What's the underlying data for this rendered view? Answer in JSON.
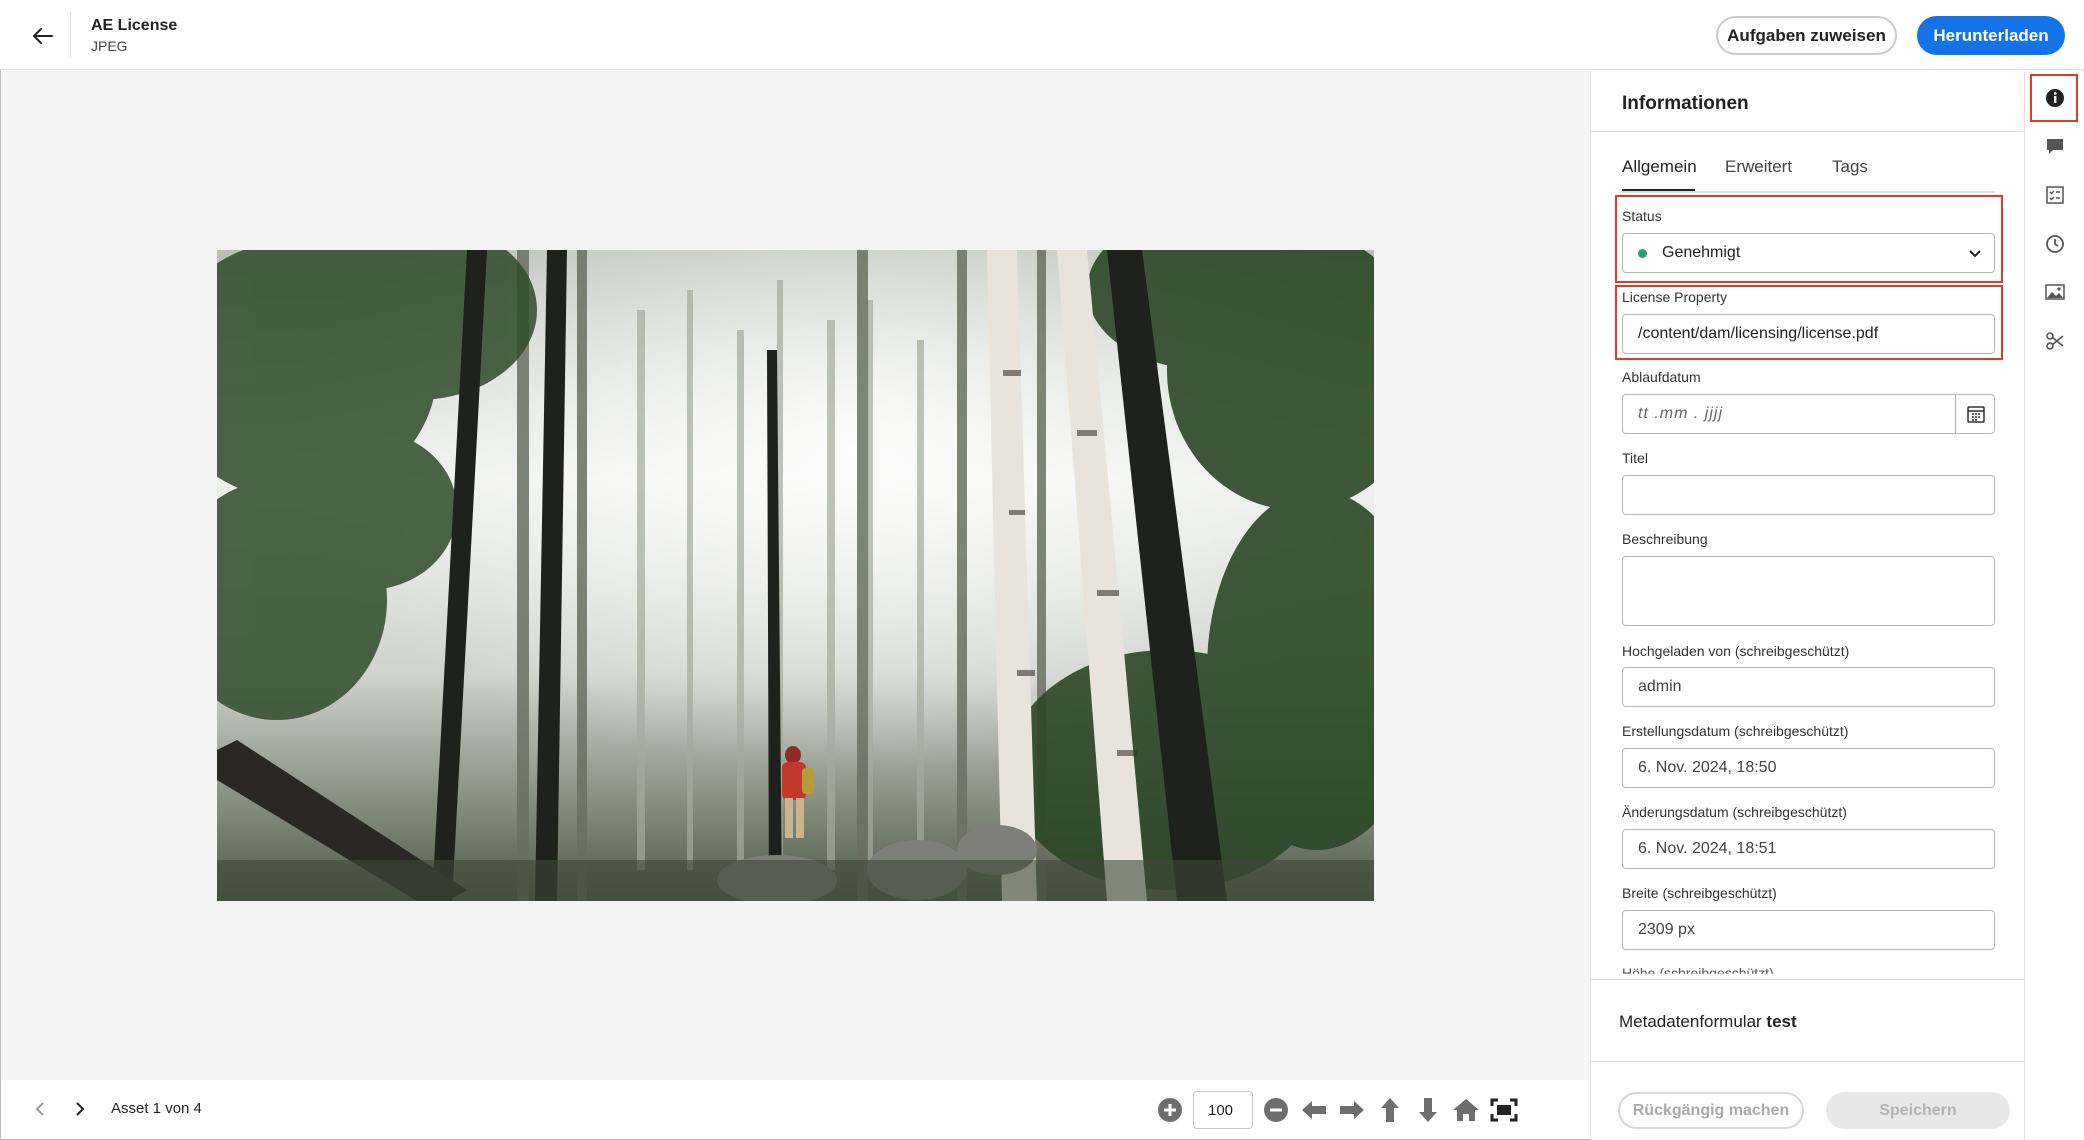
{
  "header": {
    "back_label": "Zurück",
    "title": "AE License",
    "subtitle": "JPEG",
    "assign_label": "Aufgaben zuweisen",
    "download_label": "Herunterladen"
  },
  "footer": {
    "asset_counter": "Asset 1 von 4",
    "zoom_value": "100"
  },
  "panel": {
    "title": "Informationen",
    "tabs": [
      {
        "label": "Allgemein",
        "active": true
      },
      {
        "label": "Erweitert",
        "active": false
      },
      {
        "label": "Tags",
        "active": false
      }
    ],
    "fields": {
      "status": {
        "label": "Status",
        "value": "Genehmigt",
        "dot_color": "#2d9d78"
      },
      "license": {
        "label": "License Property",
        "value": "/content/dam/licensing/license.pdf"
      },
      "expiry": {
        "label": "Ablaufdatum",
        "placeholder": "tt .mm .  jjjj"
      },
      "title": {
        "label": "Titel",
        "value": ""
      },
      "description": {
        "label": "Beschreibung",
        "value": ""
      },
      "uploaded_by": {
        "label": "Hochgeladen von (schreibgeschützt)",
        "value": "admin"
      },
      "created": {
        "label": "Erstellungsdatum (schreibgeschützt)",
        "value": "6. Nov. 2024, 18:50"
      },
      "modified": {
        "label": "Änderungsdatum (schreibgeschützt)",
        "value": "6. Nov. 2024, 18:51"
      },
      "width": {
        "label": "Breite (schreibgeschützt)",
        "value": "2309 px"
      },
      "height": {
        "label": "Höhe (schreibgeschützt)"
      }
    },
    "metadata_form_prefix": "Metadatenformular",
    "metadata_form_name": "test",
    "undo_label": "Rückgängig machen",
    "save_label": "Speichern"
  },
  "rail": {
    "icons": [
      "info-icon",
      "comment-icon",
      "tasks-icon",
      "history-icon",
      "renditions-icon",
      "cut-icon"
    ]
  },
  "colors": {
    "accent": "#1473e6",
    "highlight": "#e03a2a",
    "status_green": "#2d9d78"
  }
}
